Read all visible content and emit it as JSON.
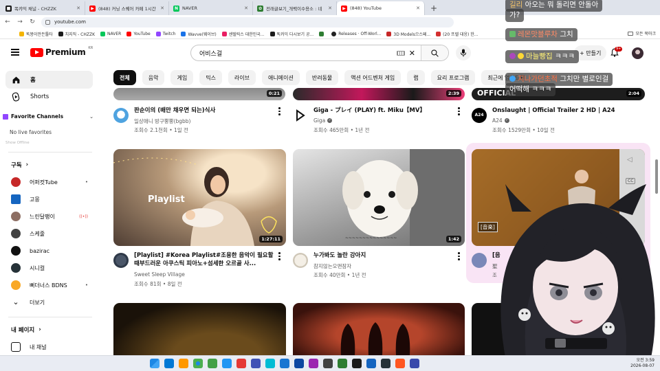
{
  "browser": {
    "tabs": [
      {
        "title": "똑캬익 채널 - CHZZK",
        "color": "#1b1b1b"
      },
      {
        "title": "(848) 커닝 스퀘어 카페 1시간",
        "color": "#ff0000"
      },
      {
        "title": "NAVER",
        "color": "#03c75a"
      },
      {
        "title": "전래글보기_개백이수용소 : 네",
        "color": "#2e7d32"
      },
      {
        "title": "(848) YouTube",
        "color": "#ff0000",
        "active": true
      }
    ],
    "new_tab": "+",
    "url": "youtube.com",
    "bookmarks": [
      {
        "label": "똑봉이만든툴타",
        "color": "#f4b400"
      },
      {
        "label": "치지직 - CHZZK",
        "color": "#1b1b1b"
      },
      {
        "label": "NAVER",
        "color": "#03c75a"
      },
      {
        "label": "YouTube",
        "color": "#ff0000"
      },
      {
        "label": "Twitch",
        "color": "#9146ff"
      },
      {
        "label": "Wavve(웨이브)",
        "color": "#1a73e8"
      },
      {
        "label": "센텔릭스 대한민국...",
        "color": "#e91e63"
      },
      {
        "label": "똑캬익 다시보기 공...",
        "color": "#1b1b1b"
      },
      {
        "label": "",
        "color": "#2e7d32"
      },
      {
        "label": "Releases · Off-Worl...",
        "color": "#222222"
      },
      {
        "label": "3D Models으스페...",
        "color": "#c62828"
      },
      {
        "label": "(20 프렐 대응) 한...",
        "color": "#d32f2f"
      }
    ],
    "bookmarks_folder": "모든 북마크"
  },
  "header": {
    "logo_text": "Premium",
    "country": "KR",
    "search_value": "어비스걸",
    "create_label": "+ 만들기",
    "notifications_badge": "9+"
  },
  "sidebar": {
    "home": "홈",
    "shorts": "Shorts",
    "favorite_channels": "Favorite Channels",
    "no_live": "No live favorites",
    "show_offline": "Show Offline",
    "subscriptions_title": "구독",
    "subs": [
      {
        "name": "어퍼컷Tube",
        "color": "#c62828",
        "live": "•"
      },
      {
        "name": "고몽",
        "color": "#1565c0",
        "live": ""
      },
      {
        "name": "느린달팽이",
        "color": "#8d6e63",
        "live": "((•))"
      },
      {
        "name": "스케줄",
        "color": "#424242",
        "live": ""
      },
      {
        "name": "bazirac",
        "color": "#111111",
        "live": ""
      },
      {
        "name": "시니컬",
        "color": "#263238",
        "live": ""
      },
      {
        "name": "뻐더너스 BDNS",
        "color": "#f9a825",
        "live": "•"
      }
    ],
    "more": "더보기",
    "my_page_title": "내 페이지",
    "my_channel": "내 채널"
  },
  "chips": [
    "전체",
    "음악",
    "게임",
    "믹스",
    "라이브",
    "애니메이션",
    "반려동물",
    "액션 어드벤처 게임",
    "랩",
    "요리 프로그램",
    "최근에 업로드된"
  ],
  "videos": {
    "row1": [
      {
        "title": "판순이의 (배만 채우면 되는)식사",
        "channel": "일상애니 방구뿡뿡(bgbb)",
        "stats": "조회수 2.1천회 • 1일 전",
        "duration": "0:21",
        "verified": false
      },
      {
        "title": "Giga - プレイ (PLAY) ft. Miku【MV】",
        "channel": "Giga",
        "stats": "조회수 465만회 • 1년 전",
        "duration": "2:39",
        "verified": true
      },
      {
        "title": "Onslaught | Official Trailer 2 HD | A24",
        "channel": "A24",
        "stats": "조회수 1529만회 • 10일 전",
        "duration": "2:04",
        "verified": true,
        "thumb_text": "OFFICIAL",
        "avatar_text": "A24"
      }
    ],
    "row2": [
      {
        "title": "[Playlist] #Korea Playlist#조용한 음악이 필요할 때부드러운 아쿠스틱 피아노+섬세한 오르골 사...",
        "channel": "Sweet Sleep Village",
        "stats": "조회수 81회 • 8일 전",
        "duration": "1:27:11",
        "thumb_text": "Playlist",
        "verified": false
      },
      {
        "title": "누가봐도 놀란 강아지",
        "channel": "참지않는오맨잠자",
        "stats": "조회수 40만회 • 1년 전",
        "duration": "1:42",
        "verified": false,
        "thumb_text": "~~~~~~~~~~~~~~~"
      },
      {
        "title": "[음",
        "channel": "聖",
        "stats": "조",
        "duration": "",
        "verified": false,
        "thumb_text": "[音楽]",
        "cc": "CC"
      }
    ]
  },
  "chat": [
    {
      "user": "길리",
      "text": "아오는 뭐 돌리면 안돌아",
      "line2": "가?"
    },
    {
      "user": "레몬맛블루차",
      "text": "그치"
    },
    {
      "user": "마늘빵집",
      "text": "ㅋㅋㅋ"
    },
    {
      "user": "지나가던초적",
      "text": "그치만 별로인걸",
      "line2": "어떡해 ㅋㅋㅋ"
    }
  ],
  "taskbar": {
    "time": "오전 3:59",
    "date": "2026-08-07",
    "icons": [
      "#1e88e5",
      "#0078d4",
      "#ff9800",
      "#4caf50",
      "#43a047",
      "#2196f3",
      "#e53935",
      "#3f51b5",
      "#00bcd4",
      "#1976d2",
      "#0d47a1",
      "#9c27b0",
      "#424242",
      "#2e7d32",
      "#1b1b1b",
      "#1565c0",
      "#263238",
      "#ff5722",
      "#3949ab"
    ]
  },
  "colors": {
    "accent": "#ff0000",
    "chip_active": "#0f0f0f",
    "chip": "#f2f2f2"
  }
}
